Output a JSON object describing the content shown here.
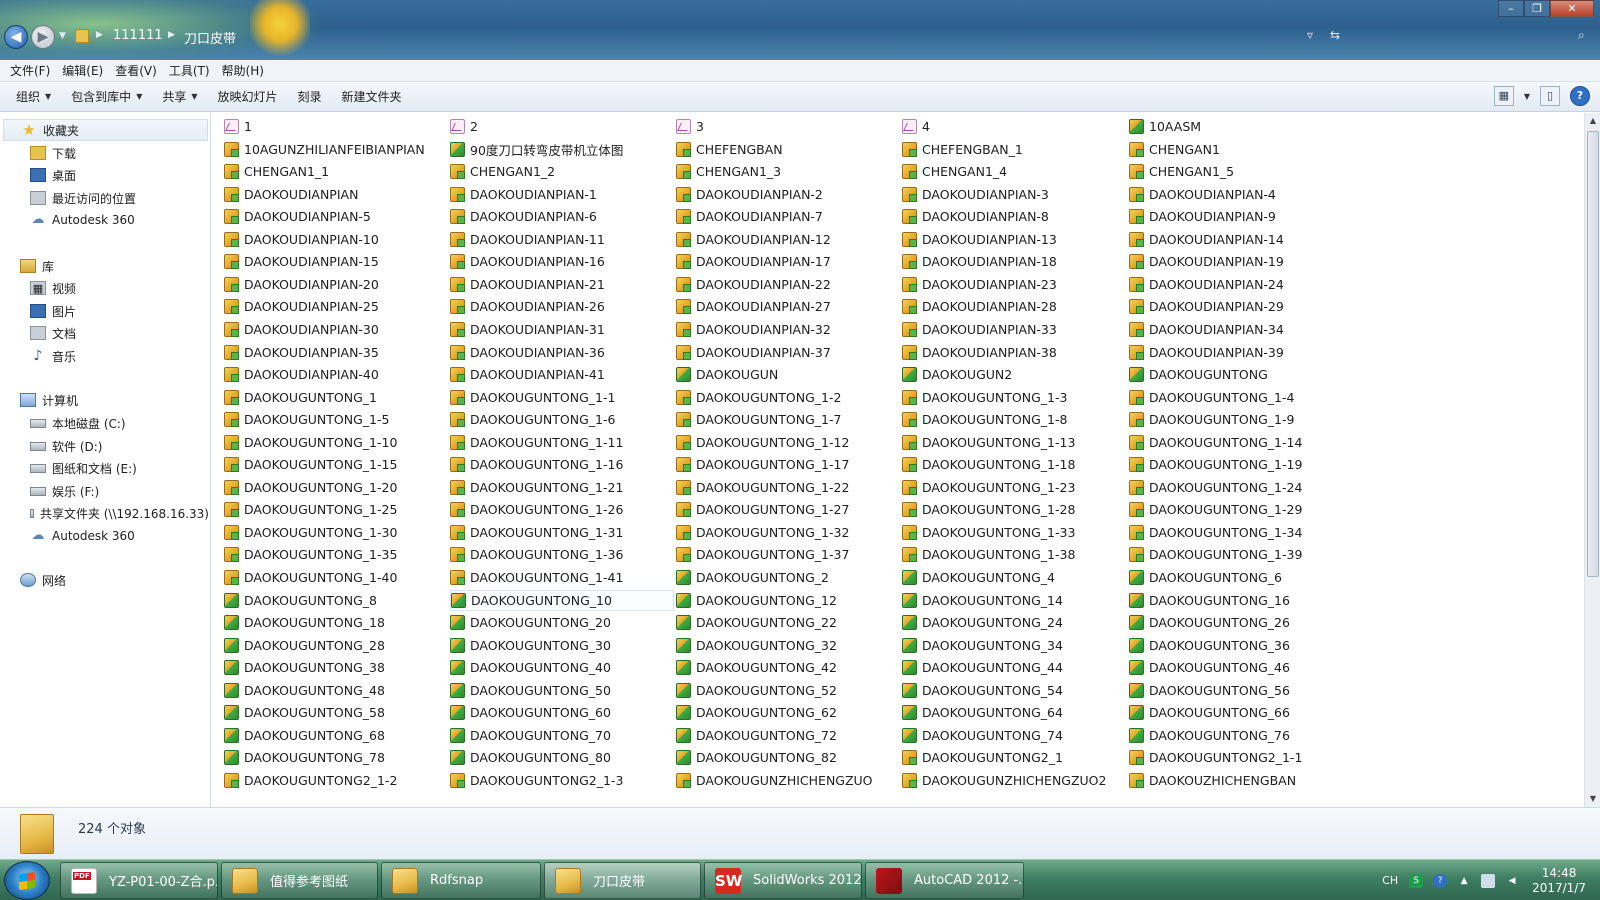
{
  "address": {
    "segments": [
      "111111",
      "刀口皮带"
    ]
  },
  "window_controls": {
    "minimize": "–",
    "maximize": "❐",
    "close": "✕"
  },
  "menubar": [
    "文件(F)",
    "编辑(E)",
    "查看(V)",
    "工具(T)",
    "帮助(H)"
  ],
  "toolbar": {
    "organize": "组织",
    "include_in_library": "包含到库中",
    "share": "共享",
    "slideshow": "放映幻灯片",
    "burn": "刻录",
    "new_folder": "新建文件夹"
  },
  "navpane": {
    "favorites": "收藏夹",
    "favorite_items": [
      "下载",
      "桌面",
      "最近访问的位置",
      "Autodesk 360"
    ],
    "libraries": "库",
    "library_items": [
      "视频",
      "图片",
      "文档",
      "音乐"
    ],
    "computer": "计算机",
    "computer_items": [
      "本地磁盘 (C:)",
      "软件 (D:)",
      "图纸和文档 (E:)",
      "娱乐 (F:)",
      "共享文件夹 (\\\\192.168.16.33)",
      "Autodesk 360"
    ],
    "network": "网络"
  },
  "files": [
    {
      "name": "1",
      "type": "drw"
    },
    {
      "name": "2",
      "type": "drw"
    },
    {
      "name": "3",
      "type": "drw"
    },
    {
      "name": "4",
      "type": "drw"
    },
    {
      "name": "10AASM",
      "type": "assy"
    },
    {
      "name": "10AGUNZHILIANFEIBIANPIAN",
      "type": "part"
    },
    {
      "name": "90度刀口转弯皮带机立体图",
      "type": "assy"
    },
    {
      "name": "CHEFENGBAN",
      "type": "part"
    },
    {
      "name": "CHEFENGBAN_1",
      "type": "part"
    },
    {
      "name": "CHENGAN1",
      "type": "part"
    },
    {
      "name": "CHENGAN1_1",
      "type": "part"
    },
    {
      "name": "CHENGAN1_2",
      "type": "part"
    },
    {
      "name": "CHENGAN1_3",
      "type": "part"
    },
    {
      "name": "CHENGAN1_4",
      "type": "part"
    },
    {
      "name": "CHENGAN1_5",
      "type": "part"
    },
    {
      "name": "DAOKOUDIANPIAN",
      "type": "part"
    },
    {
      "name": "DAOKOUDIANPIAN-1",
      "type": "part"
    },
    {
      "name": "DAOKOUDIANPIAN-2",
      "type": "part"
    },
    {
      "name": "DAOKOUDIANPIAN-3",
      "type": "part"
    },
    {
      "name": "DAOKOUDIANPIAN-4",
      "type": "part"
    },
    {
      "name": "DAOKOUDIANPIAN-5",
      "type": "part"
    },
    {
      "name": "DAOKOUDIANPIAN-6",
      "type": "part"
    },
    {
      "name": "DAOKOUDIANPIAN-7",
      "type": "part"
    },
    {
      "name": "DAOKOUDIANPIAN-8",
      "type": "part"
    },
    {
      "name": "DAOKOUDIANPIAN-9",
      "type": "part"
    },
    {
      "name": "DAOKOUDIANPIAN-10",
      "type": "part"
    },
    {
      "name": "DAOKOUDIANPIAN-11",
      "type": "part"
    },
    {
      "name": "DAOKOUDIANPIAN-12",
      "type": "part"
    },
    {
      "name": "DAOKOUDIANPIAN-13",
      "type": "part"
    },
    {
      "name": "DAOKOUDIANPIAN-14",
      "type": "part"
    },
    {
      "name": "DAOKOUDIANPIAN-15",
      "type": "part"
    },
    {
      "name": "DAOKOUDIANPIAN-16",
      "type": "part"
    },
    {
      "name": "DAOKOUDIANPIAN-17",
      "type": "part"
    },
    {
      "name": "DAOKOUDIANPIAN-18",
      "type": "part"
    },
    {
      "name": "DAOKOUDIANPIAN-19",
      "type": "part"
    },
    {
      "name": "DAOKOUDIANPIAN-20",
      "type": "part"
    },
    {
      "name": "DAOKOUDIANPIAN-21",
      "type": "part"
    },
    {
      "name": "DAOKOUDIANPIAN-22",
      "type": "part"
    },
    {
      "name": "DAOKOUDIANPIAN-23",
      "type": "part"
    },
    {
      "name": "DAOKOUDIANPIAN-24",
      "type": "part"
    },
    {
      "name": "DAOKOUDIANPIAN-25",
      "type": "part"
    },
    {
      "name": "DAOKOUDIANPIAN-26",
      "type": "part"
    },
    {
      "name": "DAOKOUDIANPIAN-27",
      "type": "part"
    },
    {
      "name": "DAOKOUDIANPIAN-28",
      "type": "part"
    },
    {
      "name": "DAOKOUDIANPIAN-29",
      "type": "part"
    },
    {
      "name": "DAOKOUDIANPIAN-30",
      "type": "part"
    },
    {
      "name": "DAOKOUDIANPIAN-31",
      "type": "part"
    },
    {
      "name": "DAOKOUDIANPIAN-32",
      "type": "part"
    },
    {
      "name": "DAOKOUDIANPIAN-33",
      "type": "part"
    },
    {
      "name": "DAOKOUDIANPIAN-34",
      "type": "part"
    },
    {
      "name": "DAOKOUDIANPIAN-35",
      "type": "part"
    },
    {
      "name": "DAOKOUDIANPIAN-36",
      "type": "part"
    },
    {
      "name": "DAOKOUDIANPIAN-37",
      "type": "part"
    },
    {
      "name": "DAOKOUDIANPIAN-38",
      "type": "part"
    },
    {
      "name": "DAOKOUDIANPIAN-39",
      "type": "part"
    },
    {
      "name": "DAOKOUDIANPIAN-40",
      "type": "part"
    },
    {
      "name": "DAOKOUDIANPIAN-41",
      "type": "part"
    },
    {
      "name": "DAOKOUGUN",
      "type": "assy"
    },
    {
      "name": "DAOKOUGUN2",
      "type": "assy"
    },
    {
      "name": "DAOKOUGUNTONG",
      "type": "assy"
    },
    {
      "name": "DAOKOUGUNTONG_1",
      "type": "part"
    },
    {
      "name": "DAOKOUGUNTONG_1-1",
      "type": "part"
    },
    {
      "name": "DAOKOUGUNTONG_1-2",
      "type": "part"
    },
    {
      "name": "DAOKOUGUNTONG_1-3",
      "type": "part"
    },
    {
      "name": "DAOKOUGUNTONG_1-4",
      "type": "part"
    },
    {
      "name": "DAOKOUGUNTONG_1-5",
      "type": "part"
    },
    {
      "name": "DAOKOUGUNTONG_1-6",
      "type": "part"
    },
    {
      "name": "DAOKOUGUNTONG_1-7",
      "type": "part"
    },
    {
      "name": "DAOKOUGUNTONG_1-8",
      "type": "part"
    },
    {
      "name": "DAOKOUGUNTONG_1-9",
      "type": "part"
    },
    {
      "name": "DAOKOUGUNTONG_1-10",
      "type": "part"
    },
    {
      "name": "DAOKOUGUNTONG_1-11",
      "type": "part"
    },
    {
      "name": "DAOKOUGUNTONG_1-12",
      "type": "part"
    },
    {
      "name": "DAOKOUGUNTONG_1-13",
      "type": "part"
    },
    {
      "name": "DAOKOUGUNTONG_1-14",
      "type": "part"
    },
    {
      "name": "DAOKOUGUNTONG_1-15",
      "type": "part"
    },
    {
      "name": "DAOKOUGUNTONG_1-16",
      "type": "part"
    },
    {
      "name": "DAOKOUGUNTONG_1-17",
      "type": "part"
    },
    {
      "name": "DAOKOUGUNTONG_1-18",
      "type": "part"
    },
    {
      "name": "DAOKOUGUNTONG_1-19",
      "type": "part"
    },
    {
      "name": "DAOKOUGUNTONG_1-20",
      "type": "part"
    },
    {
      "name": "DAOKOUGUNTONG_1-21",
      "type": "part"
    },
    {
      "name": "DAOKOUGUNTONG_1-22",
      "type": "part"
    },
    {
      "name": "DAOKOUGUNTONG_1-23",
      "type": "part"
    },
    {
      "name": "DAOKOUGUNTONG_1-24",
      "type": "part"
    },
    {
      "name": "DAOKOUGUNTONG_1-25",
      "type": "part"
    },
    {
      "name": "DAOKOUGUNTONG_1-26",
      "type": "part"
    },
    {
      "name": "DAOKOUGUNTONG_1-27",
      "type": "part"
    },
    {
      "name": "DAOKOUGUNTONG_1-28",
      "type": "part"
    },
    {
      "name": "DAOKOUGUNTONG_1-29",
      "type": "part"
    },
    {
      "name": "DAOKOUGUNTONG_1-30",
      "type": "part"
    },
    {
      "name": "DAOKOUGUNTONG_1-31",
      "type": "part"
    },
    {
      "name": "DAOKOUGUNTONG_1-32",
      "type": "part"
    },
    {
      "name": "DAOKOUGUNTONG_1-33",
      "type": "part"
    },
    {
      "name": "DAOKOUGUNTONG_1-34",
      "type": "part"
    },
    {
      "name": "DAOKOUGUNTONG_1-35",
      "type": "part"
    },
    {
      "name": "DAOKOUGUNTONG_1-36",
      "type": "part"
    },
    {
      "name": "DAOKOUGUNTONG_1-37",
      "type": "part"
    },
    {
      "name": "DAOKOUGUNTONG_1-38",
      "type": "part"
    },
    {
      "name": "DAOKOUGUNTONG_1-39",
      "type": "part"
    },
    {
      "name": "DAOKOUGUNTONG_1-40",
      "type": "part"
    },
    {
      "name": "DAOKOUGUNTONG_1-41",
      "type": "part"
    },
    {
      "name": "DAOKOUGUNTONG_2",
      "type": "assy"
    },
    {
      "name": "DAOKOUGUNTONG_4",
      "type": "assy"
    },
    {
      "name": "DAOKOUGUNTONG_6",
      "type": "assy"
    },
    {
      "name": "DAOKOUGUNTONG_8",
      "type": "assy"
    },
    {
      "name": "DAOKOUGUNTONG_10",
      "type": "assy",
      "selected": true
    },
    {
      "name": "DAOKOUGUNTONG_12",
      "type": "assy"
    },
    {
      "name": "DAOKOUGUNTONG_14",
      "type": "assy"
    },
    {
      "name": "DAOKOUGUNTONG_16",
      "type": "assy"
    },
    {
      "name": "DAOKOUGUNTONG_18",
      "type": "assy"
    },
    {
      "name": "DAOKOUGUNTONG_20",
      "type": "assy"
    },
    {
      "name": "DAOKOUGUNTONG_22",
      "type": "assy"
    },
    {
      "name": "DAOKOUGUNTONG_24",
      "type": "assy"
    },
    {
      "name": "DAOKOUGUNTONG_26",
      "type": "assy"
    },
    {
      "name": "DAOKOUGUNTONG_28",
      "type": "assy"
    },
    {
      "name": "DAOKOUGUNTONG_30",
      "type": "assy"
    },
    {
      "name": "DAOKOUGUNTONG_32",
      "type": "assy"
    },
    {
      "name": "DAOKOUGUNTONG_34",
      "type": "assy"
    },
    {
      "name": "DAOKOUGUNTONG_36",
      "type": "assy"
    },
    {
      "name": "DAOKOUGUNTONG_38",
      "type": "assy"
    },
    {
      "name": "DAOKOUGUNTONG_40",
      "type": "assy"
    },
    {
      "name": "DAOKOUGUNTONG_42",
      "type": "assy"
    },
    {
      "name": "DAOKOUGUNTONG_44",
      "type": "assy"
    },
    {
      "name": "DAOKOUGUNTONG_46",
      "type": "assy"
    },
    {
      "name": "DAOKOUGUNTONG_48",
      "type": "assy"
    },
    {
      "name": "DAOKOUGUNTONG_50",
      "type": "assy"
    },
    {
      "name": "DAOKOUGUNTONG_52",
      "type": "assy"
    },
    {
      "name": "DAOKOUGUNTONG_54",
      "type": "assy"
    },
    {
      "name": "DAOKOUGUNTONG_56",
      "type": "assy"
    },
    {
      "name": "DAOKOUGUNTONG_58",
      "type": "assy"
    },
    {
      "name": "DAOKOUGUNTONG_60",
      "type": "assy"
    },
    {
      "name": "DAOKOUGUNTONG_62",
      "type": "assy"
    },
    {
      "name": "DAOKOUGUNTONG_64",
      "type": "assy"
    },
    {
      "name": "DAOKOUGUNTONG_66",
      "type": "assy"
    },
    {
      "name": "DAOKOUGUNTONG_68",
      "type": "assy"
    },
    {
      "name": "DAOKOUGUNTONG_70",
      "type": "assy"
    },
    {
      "name": "DAOKOUGUNTONG_72",
      "type": "assy"
    },
    {
      "name": "DAOKOUGUNTONG_74",
      "type": "assy"
    },
    {
      "name": "DAOKOUGUNTONG_76",
      "type": "assy"
    },
    {
      "name": "DAOKOUGUNTONG_78",
      "type": "assy"
    },
    {
      "name": "DAOKOUGUNTONG_80",
      "type": "assy"
    },
    {
      "name": "DAOKOUGUNTONG_82",
      "type": "assy"
    },
    {
      "name": "DAOKOUGUNTONG2_1",
      "type": "part"
    },
    {
      "name": "DAOKOUGUNTONG2_1-1",
      "type": "part"
    },
    {
      "name": "DAOKOUGUNTONG2_1-2",
      "type": "part"
    },
    {
      "name": "DAOKOUGUNTONG2_1-3",
      "type": "part"
    },
    {
      "name": "DAOKOUGUNZHICHENGZUO",
      "type": "part"
    },
    {
      "name": "DAOKOUGUNZHICHENGZUO2",
      "type": "part"
    },
    {
      "name": "DAOKOUZHICHENGBAN",
      "type": "part"
    }
  ],
  "status": {
    "object_count": "224 个对象"
  },
  "taskbar": {
    "tasks": [
      {
        "label": "YZ-P01-00-Z合.p...",
        "icon": "pdf"
      },
      {
        "label": "值得参考图纸",
        "icon": "folder"
      },
      {
        "label": "Rdfsnap",
        "icon": "folder"
      },
      {
        "label": "刀口皮带",
        "icon": "folder",
        "active": true
      },
      {
        "label": "SolidWorks 2012",
        "icon": "sw"
      },
      {
        "label": "AutoCAD 2012 -...",
        "icon": "acad"
      }
    ],
    "ime": "CH",
    "time": "14:48",
    "date": "2017/1/7"
  }
}
